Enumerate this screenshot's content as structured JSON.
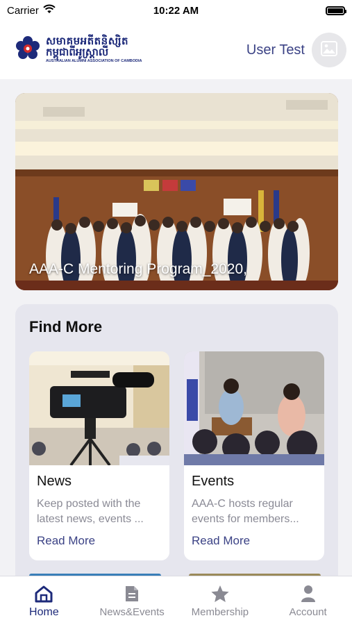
{
  "status_bar": {
    "carrier": "Carrier",
    "time": "10:22 AM"
  },
  "header": {
    "logo": {
      "khmer_line1": "សមាគមអតីតនិស្សិត",
      "khmer_line2": "កម្ពុជាពីអូស្ត្រាលី",
      "english": "AUSTRALIAN ALUMNI ASSOCIATION OF CAMBODIA"
    },
    "user_name": "User Test"
  },
  "banner": {
    "caption": "AAA-C Mentoring Program_2020,"
  },
  "find_more": {
    "title": "Find More",
    "cards": [
      {
        "title": "News",
        "description": "Keep posted with the latest news, events ...",
        "link": "Read More"
      },
      {
        "title": "Events",
        "description": "AAA-C hosts regular events for members...",
        "link": "Read More"
      }
    ]
  },
  "tab_bar": {
    "items": [
      {
        "label": "Home",
        "icon": "home-icon",
        "active": true
      },
      {
        "label": "News&Events",
        "icon": "document-icon",
        "active": false
      },
      {
        "label": "Membership",
        "icon": "star-icon",
        "active": false
      },
      {
        "label": "Account",
        "icon": "person-icon",
        "active": false
      }
    ]
  },
  "colors": {
    "brand": "#1d2a7a",
    "link": "#3b4285",
    "inactive": "#8a8a93",
    "panel": "#e6e6ee"
  }
}
